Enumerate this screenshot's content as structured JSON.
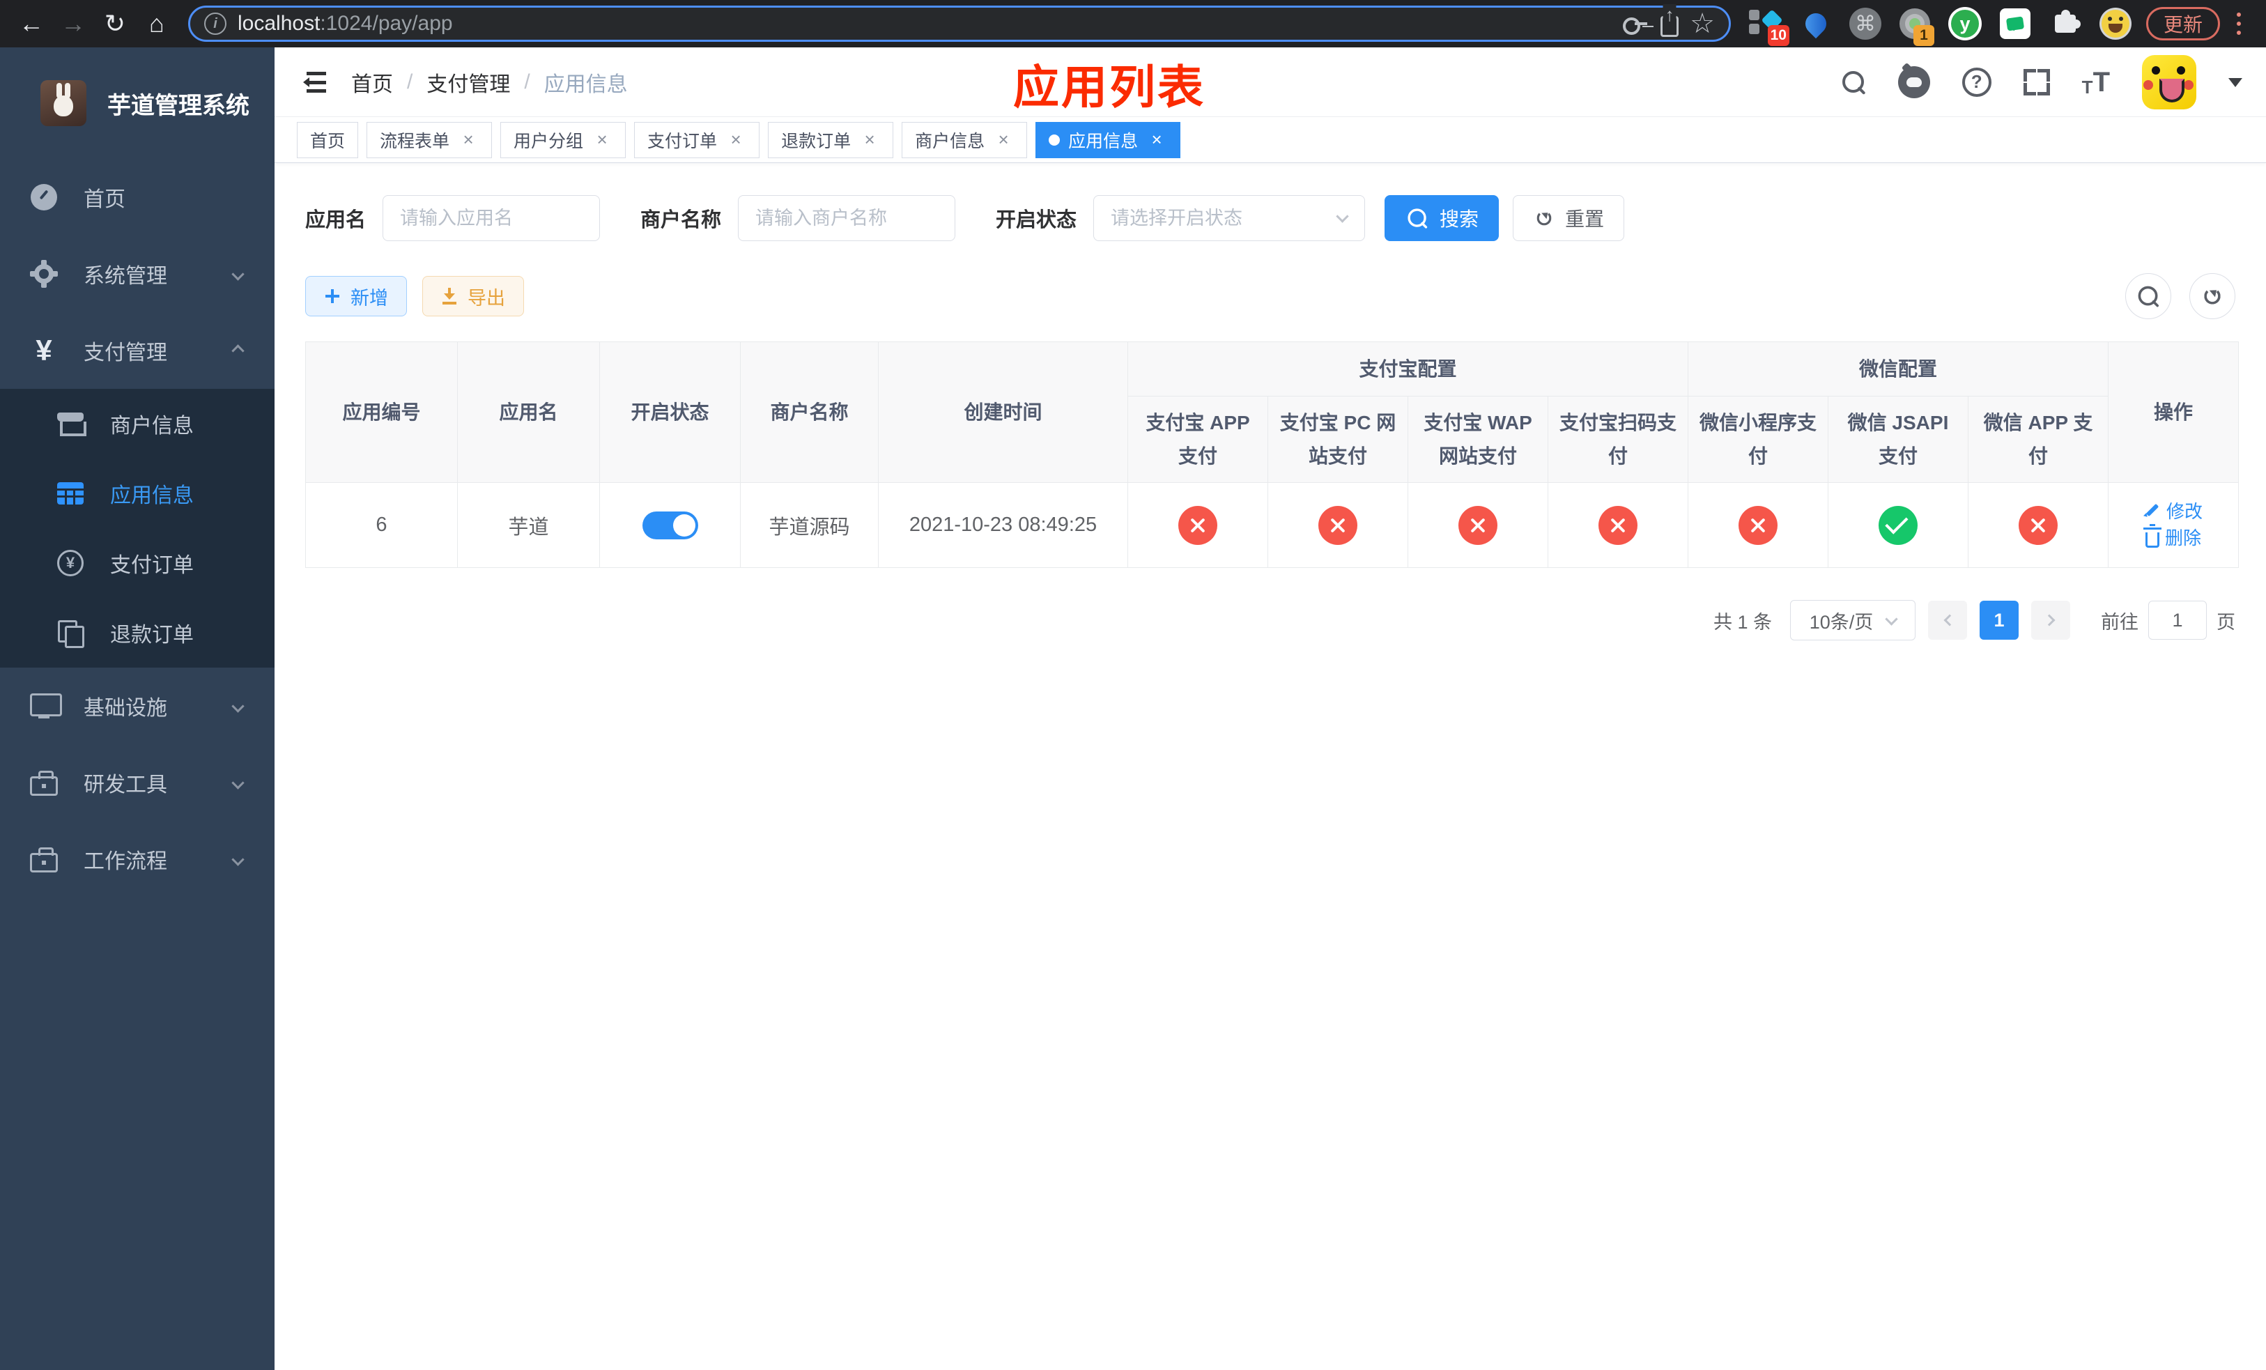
{
  "browser": {
    "url_host": "localhost",
    "url_path": ":1024/pay/app",
    "extension_badge_blue_diamond": "10",
    "extension_badge_dial": "1",
    "extension_y_letter": "y",
    "update_button": "更新"
  },
  "sidebar": {
    "title": "芋道管理系统",
    "menu": [
      {
        "label": "首页",
        "icon": "dashboard-icon",
        "expanded": false
      },
      {
        "label": "系统管理",
        "icon": "gear-icon",
        "expanded": false
      },
      {
        "label": "支付管理",
        "icon": "yen-icon",
        "expanded": true
      },
      {
        "label": "基础设施",
        "icon": "monitor-icon",
        "expanded": false
      },
      {
        "label": "研发工具",
        "icon": "toolbox-icon",
        "expanded": false
      },
      {
        "label": "工作流程",
        "icon": "toolbox-icon",
        "expanded": false
      }
    ],
    "submenu": [
      {
        "label": "商户信息",
        "icon": "shop-icon",
        "active": false
      },
      {
        "label": "应用信息",
        "icon": "grid-icon",
        "active": true
      },
      {
        "label": "支付订单",
        "icon": "yen-circle-icon",
        "active": false
      },
      {
        "label": "退款订单",
        "icon": "copy-icon",
        "active": false
      }
    ]
  },
  "navbar": {
    "breadcrumb": [
      "首页",
      "支付管理",
      "应用信息"
    ]
  },
  "overlay_title": "应用列表",
  "tags": [
    {
      "label": "首页",
      "closable": false,
      "active": false
    },
    {
      "label": "流程表单",
      "closable": true,
      "active": false
    },
    {
      "label": "用户分组",
      "closable": true,
      "active": false
    },
    {
      "label": "支付订单",
      "closable": true,
      "active": false
    },
    {
      "label": "退款订单",
      "closable": true,
      "active": false
    },
    {
      "label": "商户信息",
      "closable": true,
      "active": false
    },
    {
      "label": "应用信息",
      "closable": true,
      "active": true
    }
  ],
  "search": {
    "app_name_label": "应用名",
    "app_name_placeholder": "请输入应用名",
    "app_name_value": "",
    "merchant_label": "商户名称",
    "merchant_placeholder": "请输入商户名称",
    "merchant_value": "",
    "status_label": "开启状态",
    "status_placeholder": "请选择开启状态",
    "status_value": "",
    "search_button": "搜索",
    "reset_button": "重置"
  },
  "toolbar": {
    "add_button": "新增",
    "export_button": "导出"
  },
  "table": {
    "groups": {
      "alipay": "支付宝配置",
      "wechat": "微信配置"
    },
    "columns": [
      "应用编号",
      "应用名",
      "开启状态",
      "商户名称",
      "创建时间",
      "支付宝 APP 支付",
      "支付宝 PC 网站支付",
      "支付宝 WAP 网站支付",
      "支付宝扫码支付",
      "微信小程序支付",
      "微信 JSAPI 支付",
      "微信 APP 支付",
      "操作"
    ],
    "rows": [
      {
        "app_id": "6",
        "app_name": "芋道",
        "enabled": true,
        "merchant_name": "芋道源码",
        "created_at": "2021-10-23 08:49:25",
        "alipay_app": "disabled",
        "alipay_pc": "disabled",
        "alipay_wap": "disabled",
        "alipay_qr": "disabled",
        "wechat_lite": "disabled",
        "wechat_jsapi": "enabled",
        "wechat_app": "disabled",
        "edit_link": "修改",
        "delete_link": "删除"
      }
    ]
  },
  "pagination": {
    "total": "共 1 条",
    "page_size": "10条/页",
    "current_page": "1",
    "goto_prefix": "前往",
    "goto_value": "1",
    "goto_suffix": "页"
  },
  "colors": {
    "accent": "#2b8ef5",
    "danger_red": "#f5564a",
    "success_green": "#16c76a",
    "sidebar_bg": "#304156",
    "submenu_bg": "#1f2d3d",
    "overlay_title_red": "#fb2b01"
  }
}
